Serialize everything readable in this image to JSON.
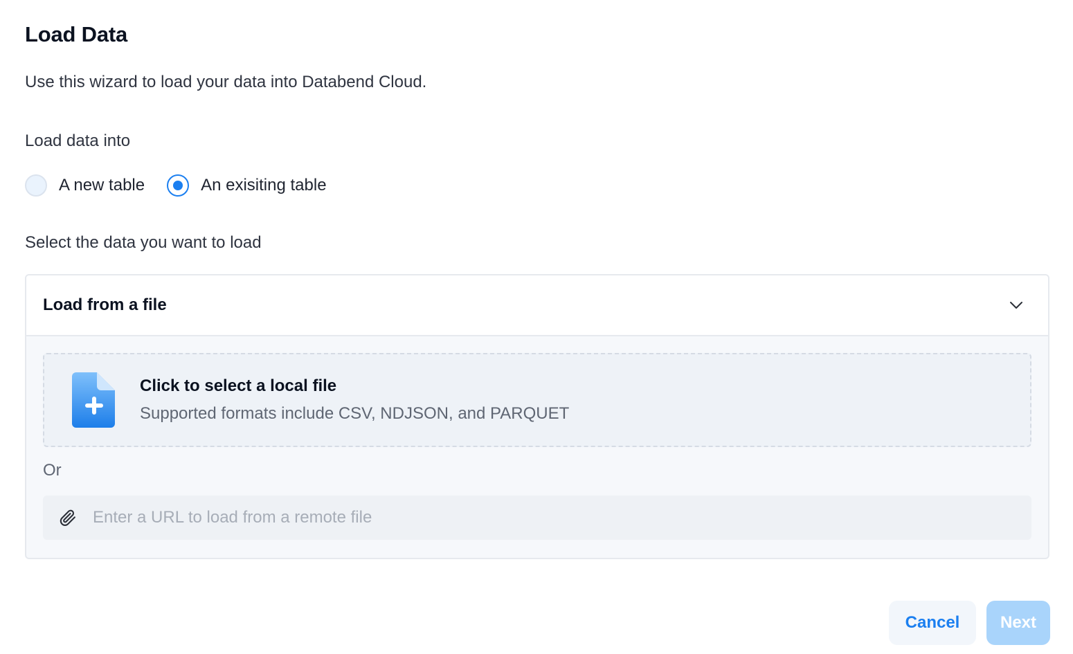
{
  "dialog": {
    "title": "Load Data",
    "subtitle": "Use this wizard to load your data into Databend Cloud."
  },
  "load_into": {
    "label": "Load data into",
    "options": [
      {
        "label": "A new table",
        "checked": false
      },
      {
        "label": "An exisiting table",
        "checked": true
      }
    ]
  },
  "select_data": {
    "label": "Select the data you want to load",
    "panel_title": "Load from a file",
    "panel_icon": "chevron-down-icon",
    "dropzone": {
      "icon": "file-add-icon",
      "title": "Click to select a local file",
      "subtitle": "Supported formats include CSV, NDJSON, and PARQUET"
    },
    "or_label": "Or",
    "url_input": {
      "icon": "paperclip-icon",
      "placeholder": "Enter a URL to load from a remote file",
      "value": ""
    }
  },
  "footer": {
    "cancel_label": "Cancel",
    "next_label": "Next"
  },
  "colors": {
    "accent": "#1b7ff0",
    "next_disabled": "#a9d4fb",
    "heading": "#0b1220"
  }
}
